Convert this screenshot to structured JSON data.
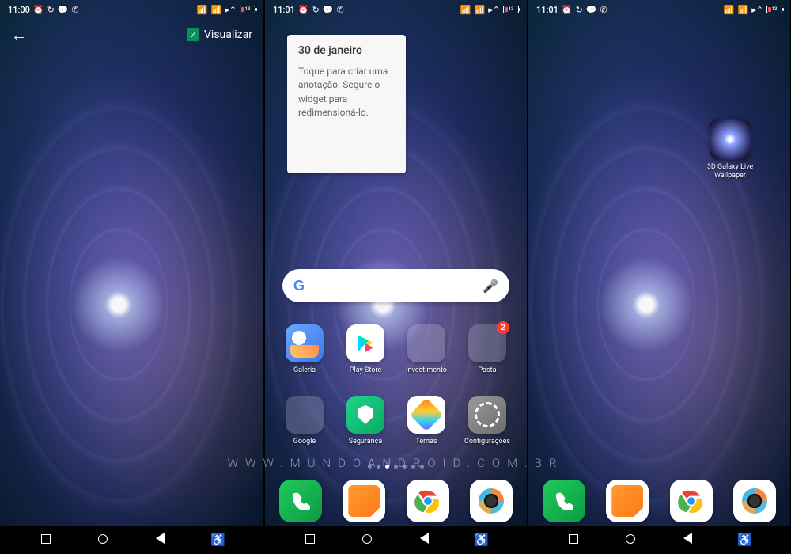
{
  "watermark": "WWW.MUNDOANDROID.COM.BR",
  "screen1": {
    "status": {
      "time": "11:00",
      "battery": "13"
    },
    "topbar": {
      "visualizar_label": "Visualizar"
    }
  },
  "screen2": {
    "status": {
      "time": "11:01",
      "battery": "13"
    },
    "note": {
      "header": "30 de janeiro",
      "body": "Toque para criar uma anotação. Segure o widget para redimensioná-lo."
    },
    "apps_row1": [
      {
        "label": "Galeria"
      },
      {
        "label": "Play Store"
      },
      {
        "label": "Investimento"
      },
      {
        "label": "Pasta",
        "badge": "2"
      }
    ],
    "apps_row2": [
      {
        "label": "Google"
      },
      {
        "label": "Segurança"
      },
      {
        "label": "Temas"
      },
      {
        "label": "Configurações"
      }
    ]
  },
  "screen3": {
    "status": {
      "time": "11:01",
      "battery": "13"
    },
    "shortcut": {
      "label": "3D Galaxy Live Wallpaper"
    }
  }
}
